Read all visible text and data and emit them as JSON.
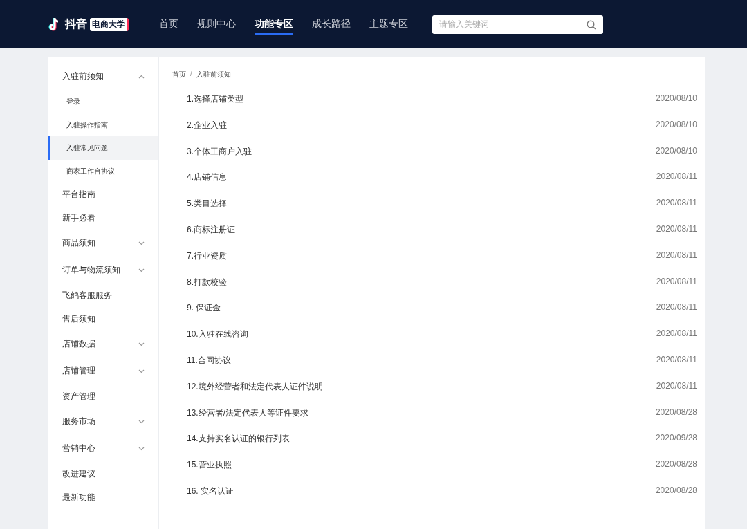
{
  "header": {
    "logo": {
      "name": "抖音",
      "badge": "电商大学"
    },
    "nav": [
      {
        "label": "首页",
        "selected": false
      },
      {
        "label": "规则中心",
        "selected": false
      },
      {
        "label": "功能专区",
        "selected": true
      },
      {
        "label": "成长路径",
        "selected": false
      },
      {
        "label": "主题专区",
        "selected": false
      }
    ],
    "search": {
      "placeholder": "请输入关键词"
    }
  },
  "sidebar": {
    "items": [
      {
        "label": "入驻前须知",
        "expanded": true,
        "children": [
          {
            "label": "登录",
            "selected": false
          },
          {
            "label": "入驻操作指南",
            "selected": false
          },
          {
            "label": "入驻常见问题",
            "selected": true
          },
          {
            "label": "商家工作台协议",
            "selected": false
          }
        ]
      },
      {
        "label": "平台指南"
      },
      {
        "label": "新手必看"
      },
      {
        "label": "商品须知",
        "expanded": false
      },
      {
        "label": "订单与物流须知",
        "expanded": false
      },
      {
        "label": "飞鸽客服服务"
      },
      {
        "label": "售后须知"
      },
      {
        "label": "店铺数据",
        "expanded": false
      },
      {
        "label": "店铺管理",
        "expanded": false
      },
      {
        "label": "资产管理"
      },
      {
        "label": "服务市场",
        "expanded": false
      },
      {
        "label": "营销中心",
        "expanded": false
      },
      {
        "label": "改进建议"
      },
      {
        "label": "最新功能"
      }
    ]
  },
  "breadcrumb": {
    "separator": "/",
    "items": [
      "首页",
      "入驻前须知"
    ]
  },
  "articles": [
    {
      "title": "1.选择店铺类型",
      "date": "2020/08/10"
    },
    {
      "title": "2.企业入驻",
      "date": "2020/08/10"
    },
    {
      "title": "3.个体工商户入驻",
      "date": "2020/08/10"
    },
    {
      "title": "4.店铺信息",
      "date": "2020/08/11"
    },
    {
      "title": "5.类目选择",
      "date": "2020/08/11"
    },
    {
      "title": "6.商标注册证",
      "date": "2020/08/11"
    },
    {
      "title": "7.行业资质",
      "date": "2020/08/11"
    },
    {
      "title": "8.打款校验",
      "date": "2020/08/11"
    },
    {
      "title": "9. 保证金",
      "date": "2020/08/11"
    },
    {
      "title": "10.入驻在线咨询",
      "date": "2020/08/11"
    },
    {
      "title": "11.合同协议",
      "date": "2020/08/11"
    },
    {
      "title": "12.境外经营者和法定代表人证件说明",
      "date": "2020/08/11"
    },
    {
      "title": "13.经营者/法定代表人等证件要求",
      "date": "2020/08/28"
    },
    {
      "title": "14.支持实名认证的银行列表",
      "date": "2020/09/28"
    },
    {
      "title": "15.营业执照",
      "date": "2020/08/28"
    },
    {
      "title": "16. 实名认证",
      "date": "2020/08/28"
    }
  ]
}
